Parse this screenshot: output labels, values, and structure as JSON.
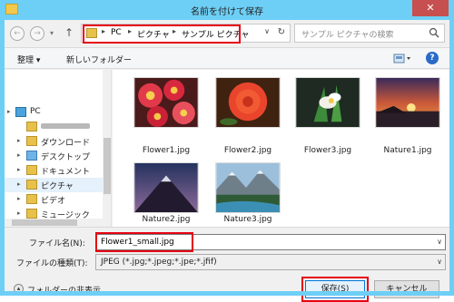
{
  "window": {
    "title": "名前を付けて保存",
    "close_glyph": "✕"
  },
  "nav": {
    "back_glyph": "←",
    "forward_glyph": "→",
    "dropdown_glyph": "▾",
    "up_glyph": "↑"
  },
  "address": {
    "chevron": "▸",
    "crumbs": [
      "PC",
      "ピクチャ",
      "サンプル ピクチャ"
    ],
    "dropdown_glyph": "∨",
    "refresh_glyph": "↻"
  },
  "search": {
    "placeholder": "サンプル ピクチャの検索"
  },
  "toolbar": {
    "organize_label": "整理 ▾",
    "new_folder_label": "新しいフォルダー",
    "help_glyph": "?"
  },
  "sidebar": {
    "items": [
      {
        "label": "PC",
        "icon": "computer-icon"
      },
      {
        "label": "",
        "icon": "user-folder-icon"
      },
      {
        "label": "ダウンロード",
        "icon": "download-folder-icon"
      },
      {
        "label": "デスクトップ",
        "icon": "desktop-folder-icon"
      },
      {
        "label": "ドキュメント",
        "icon": "documents-folder-icon"
      },
      {
        "label": "ピクチャ",
        "icon": "pictures-folder-icon"
      },
      {
        "label": "ビデオ",
        "icon": "videos-folder-icon"
      },
      {
        "label": "ミュージック",
        "icon": "music-folder-icon"
      },
      {
        "label": "",
        "icon": "drive-icon"
      }
    ]
  },
  "files": [
    {
      "name": "Flower1.jpg"
    },
    {
      "name": "Flower2.jpg"
    },
    {
      "name": "Flower3.jpg"
    },
    {
      "name": "Nature1.jpg"
    },
    {
      "name": "Nature2.jpg"
    },
    {
      "name": "Nature3.jpg"
    }
  ],
  "form": {
    "filename_label": "ファイル名(N):",
    "filename_value": "Flower1_small.jpg",
    "filetype_label": "ファイルの種類(T):",
    "filetype_value": "JPEG (*.jpg;*.jpeg;*.jpe;*.jfif)",
    "dropdown_glyph": "∨"
  },
  "actions": {
    "hide_folders_label": "フォルダーの非表示",
    "hide_glyph": "▴",
    "save_label": "保存(S)",
    "cancel_label": "キャンセル"
  },
  "colors": {
    "title_bar": "#6dcff6",
    "highlight_red": "#e60012",
    "close_red": "#c74f4f"
  }
}
